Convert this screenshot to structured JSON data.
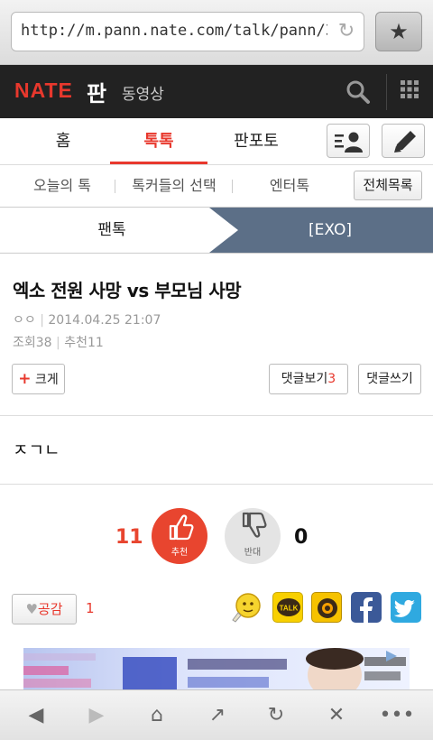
{
  "browser": {
    "url": "http://m.pann.nate.com/talk/pann/3"
  },
  "header": {
    "logo": "NATE",
    "site": "판",
    "video_link": "동영상"
  },
  "tabs": [
    {
      "label": "홈",
      "active": false
    },
    {
      "label": "톡톡",
      "active": true
    },
    {
      "label": "판포토",
      "active": false
    }
  ],
  "subnav": {
    "items": [
      "오늘의 톡",
      "톡커들의 선택",
      "엔터톡"
    ],
    "all_list": "전체목록"
  },
  "breadcrumb": {
    "left": "팬톡",
    "right": "[EXO]"
  },
  "article": {
    "title": "엑소 전원 사망 vs 부모님 사망",
    "author": "ㅇㅇ",
    "datetime": "2014.04.25 21:07",
    "views_label": "조회38",
    "recommend_label": "추천11",
    "enlarge_label": "크게",
    "view_comments_label": "댓글보기",
    "comment_count": "3",
    "write_comment_label": "댓글쓰기",
    "body": "ㅈㄱㄴ"
  },
  "votes": {
    "up_count": "11",
    "up_label": "추천",
    "down_count": "0",
    "down_label": "반대"
  },
  "sympathy": {
    "label": "공감",
    "count": "1"
  },
  "share_icons": [
    "emoticon-icon",
    "kakaotalk-icon",
    "kakaostory-icon",
    "facebook-icon",
    "twitter-icon"
  ],
  "share_text": {
    "talk": "TALK"
  },
  "colors": {
    "accent": "#e8382d",
    "breadcrumb_active": "#5c6f87",
    "header_bg": "#222222"
  }
}
